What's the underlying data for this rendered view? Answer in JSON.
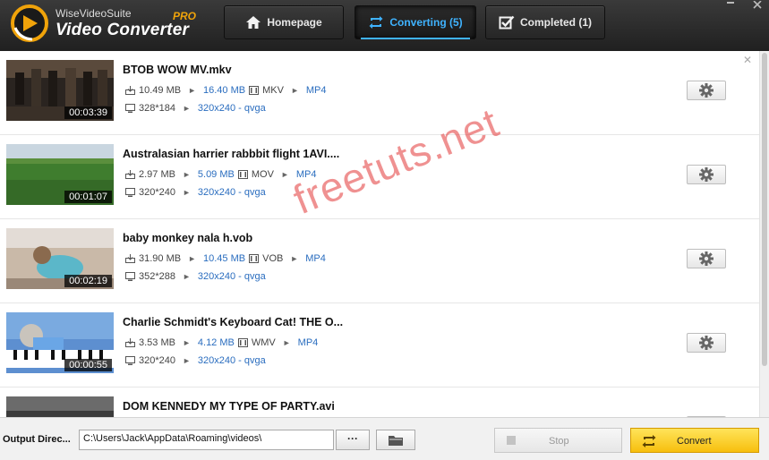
{
  "brand": {
    "name_small": "WiseVideoSuite",
    "name_big": "Video Converter",
    "edition": "PRO"
  },
  "nav": {
    "home": "Homepage",
    "converting": "Converting (5)",
    "completed": "Completed (1)"
  },
  "colors": {
    "accent": "#3fb3ff",
    "link": "#2a6dbf",
    "convert_button": "#f7bf0e",
    "watermark": "#e13737"
  },
  "videos": [
    {
      "title": "BTOB  WOW MV.mkv",
      "duration": "00:03:39",
      "src_size": "10.49 MB",
      "out_size": "16.40 MB",
      "src_format": "MKV",
      "out_format": "MP4",
      "src_res": "328*184",
      "out_res": "320x240 - qvga"
    },
    {
      "title": "Australasian harrier rabbbit flight 1AVI....",
      "duration": "00:01:07",
      "src_size": "2.97 MB",
      "out_size": "5.09 MB",
      "src_format": "MOV",
      "out_format": "MP4",
      "src_res": "320*240",
      "out_res": "320x240 - qvga"
    },
    {
      "title": "baby monkey nala h.vob",
      "duration": "00:02:19",
      "src_size": "31.90 MB",
      "out_size": "10.45 MB",
      "src_format": "VOB",
      "out_format": "MP4",
      "src_res": "352*288",
      "out_res": "320x240 - qvga"
    },
    {
      "title": "Charlie Schmidt's Keyboard Cat!  THE O...",
      "duration": "00:00:55",
      "src_size": "3.53 MB",
      "out_size": "4.12 MB",
      "src_format": "WMV",
      "out_format": "MP4",
      "src_res": "320*240",
      "out_res": "320x240 - qvga"
    },
    {
      "title": "DOM KENNEDY MY TYPE OF PARTY.avi"
    }
  ],
  "watermark": "freetuts.net",
  "footer": {
    "output_label": "Output Direc...",
    "output_path": "C:\\Users\\Jack\\AppData\\Roaming\\videos\\",
    "browse_label": "···",
    "stop_label": "Stop",
    "convert_label": "Convert"
  }
}
